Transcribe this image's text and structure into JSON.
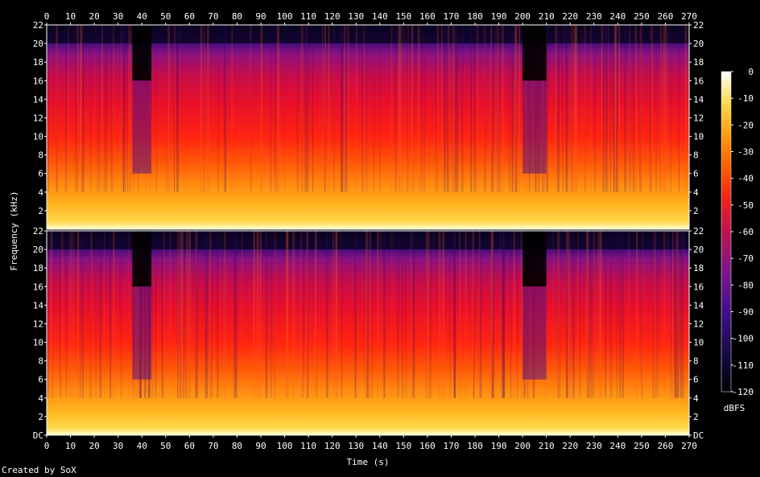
{
  "chart_data": {
    "type": "heatmap",
    "title": "",
    "xlabel": "Time (s)",
    "ylabel": "Frequency (kHz)",
    "x_ticks": [
      "0",
      "10",
      "20",
      "30",
      "40",
      "50",
      "60",
      "70",
      "80",
      "90",
      "100",
      "110",
      "120",
      "130",
      "140",
      "150",
      "160",
      "170",
      "180",
      "190",
      "200",
      "210",
      "220",
      "230",
      "240",
      "250",
      "260",
      "270"
    ],
    "x_range": [
      0,
      270
    ],
    "y_ticks": [
      "DC",
      "2",
      "4",
      "6",
      "8",
      "10",
      "12",
      "14",
      "16",
      "18",
      "20",
      "22"
    ],
    "y_range_khz": [
      0,
      22
    ],
    "channels": 2,
    "colorbar": {
      "label": "dBFS",
      "ticks": [
        "0",
        "-10",
        "-20",
        "-30",
        "-40",
        "-50",
        "-60",
        "-70",
        "-80",
        "-90",
        "-100",
        "-110",
        "-120"
      ],
      "range": [
        -120,
        0
      ],
      "colors": [
        "#000000",
        "#1a0a5a",
        "#4b0fa0",
        "#8c1290",
        "#d01040",
        "#ff2a00",
        "#ff7a00",
        "#ffc21a",
        "#fff5a0",
        "#ffffff"
      ]
    },
    "quiet_segments_s": [
      [
        36,
        44
      ],
      [
        200,
        210
      ]
    ]
  },
  "footer": {
    "credit": "Created by SoX"
  }
}
